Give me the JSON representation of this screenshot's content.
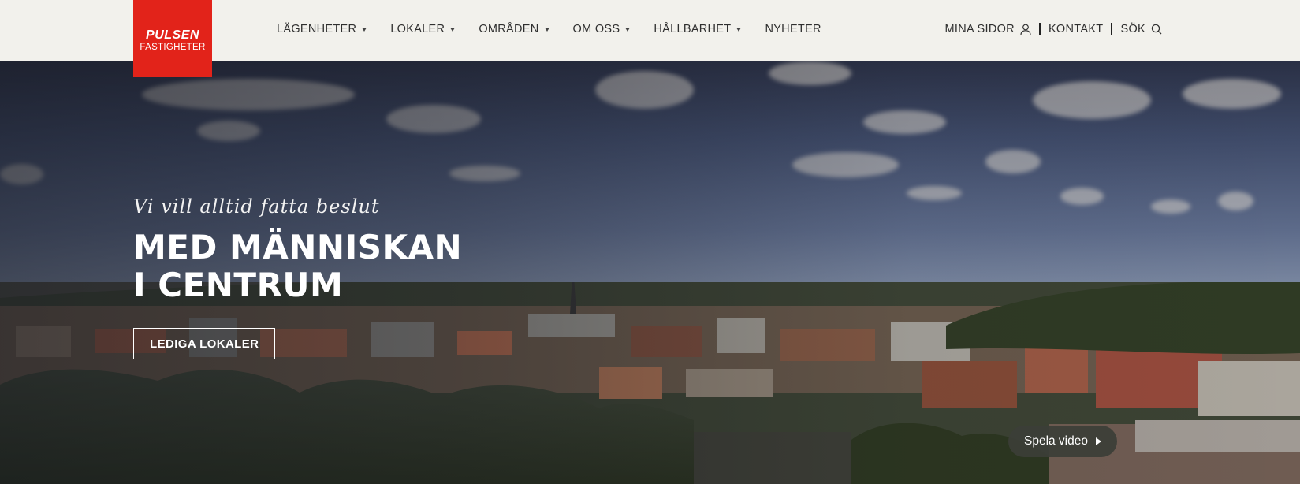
{
  "logo": {
    "brand": "PULSEN",
    "sub": "FASTIGHETER",
    "color": "#e2231a"
  },
  "nav": {
    "items": [
      {
        "label": "LÄGENHETER",
        "has_dropdown": true
      },
      {
        "label": "LOKALER",
        "has_dropdown": true
      },
      {
        "label": "OMRÅDEN",
        "has_dropdown": true
      },
      {
        "label": "OM OSS",
        "has_dropdown": true
      },
      {
        "label": "HÅLLBARHET",
        "has_dropdown": true
      },
      {
        "label": "NYHETER",
        "has_dropdown": false
      }
    ]
  },
  "utility": {
    "my_pages": "MINA SIDOR",
    "my_pages_icon": "user-icon",
    "contact": "KONTAKT",
    "search": "SÖK",
    "search_icon": "search-icon"
  },
  "hero": {
    "tagline": "Vi vill alltid fatta beslut",
    "headline_line1": "MED MÄNNISKAN",
    "headline_line2": "I CENTRUM",
    "cta": "LEDIGA LOKALER",
    "video_button": "Spela video"
  }
}
